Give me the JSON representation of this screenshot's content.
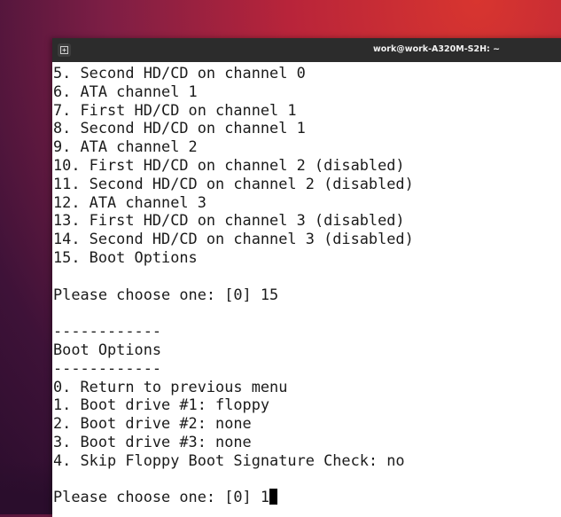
{
  "window": {
    "title": "work@work-A320M-S2H: ~",
    "tab_icon": "new-tab-icon"
  },
  "terminal": {
    "lines": [
      "5. Second HD/CD on channel 0",
      "6. ATA channel 1",
      "7. First HD/CD on channel 1",
      "8. Second HD/CD on channel 1",
      "9. ATA channel 2",
      "10. First HD/CD on channel 2 (disabled)",
      "11. Second HD/CD on channel 2 (disabled)",
      "12. ATA channel 3",
      "13. First HD/CD on channel 3 (disabled)",
      "14. Second HD/CD on channel 3 (disabled)",
      "15. Boot Options",
      "",
      "Please choose one: [0] 15",
      "",
      "------------",
      "Boot Options",
      "------------",
      "0. Return to previous menu",
      "1. Boot drive #1: floppy",
      "2. Boot drive #2: none",
      "3. Boot drive #3: none",
      "4. Skip Floppy Boot Signature Check: no",
      ""
    ],
    "prompt_line": "Please choose one: [0] 1"
  },
  "colors": {
    "terminal_bg": "#ffffff",
    "terminal_fg": "#1b1b1b",
    "titlebar_bg": "#2c2c2c"
  }
}
